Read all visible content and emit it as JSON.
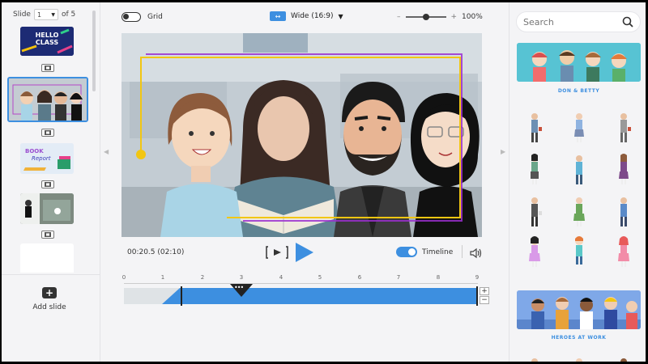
{
  "slides_panel": {
    "slide_label": "Slide",
    "current_slide": "1",
    "of_label": "of 5",
    "thumb1_line1": "HELLO",
    "thumb1_line2": "CLASS",
    "thumb3_line1": "BOOK",
    "thumb3_line2": "Report",
    "add_slide_label": "Add slide"
  },
  "toolbar": {
    "grid_label": "Grid",
    "aspect_label": "Wide (16:9)",
    "zoom_value": "100%",
    "zoom_minus": "–",
    "zoom_plus": "+"
  },
  "player": {
    "current_time": "00:20.5 (02:10)",
    "timeline_label": "Timeline"
  },
  "timeline": {
    "ticks": [
      "0",
      "1",
      "2",
      "3",
      "4",
      "5",
      "6",
      "7",
      "8",
      "9"
    ],
    "zoom_in": "+",
    "zoom_out": "−"
  },
  "library": {
    "search_placeholder": "Search",
    "banner1_label": "DON & BETTY",
    "banner2_label": "HEROES AT WORK"
  },
  "colors": {
    "accent": "#3d8fe0",
    "path_yellow": "#f2c612",
    "path_purple": "#9b2fd0"
  }
}
